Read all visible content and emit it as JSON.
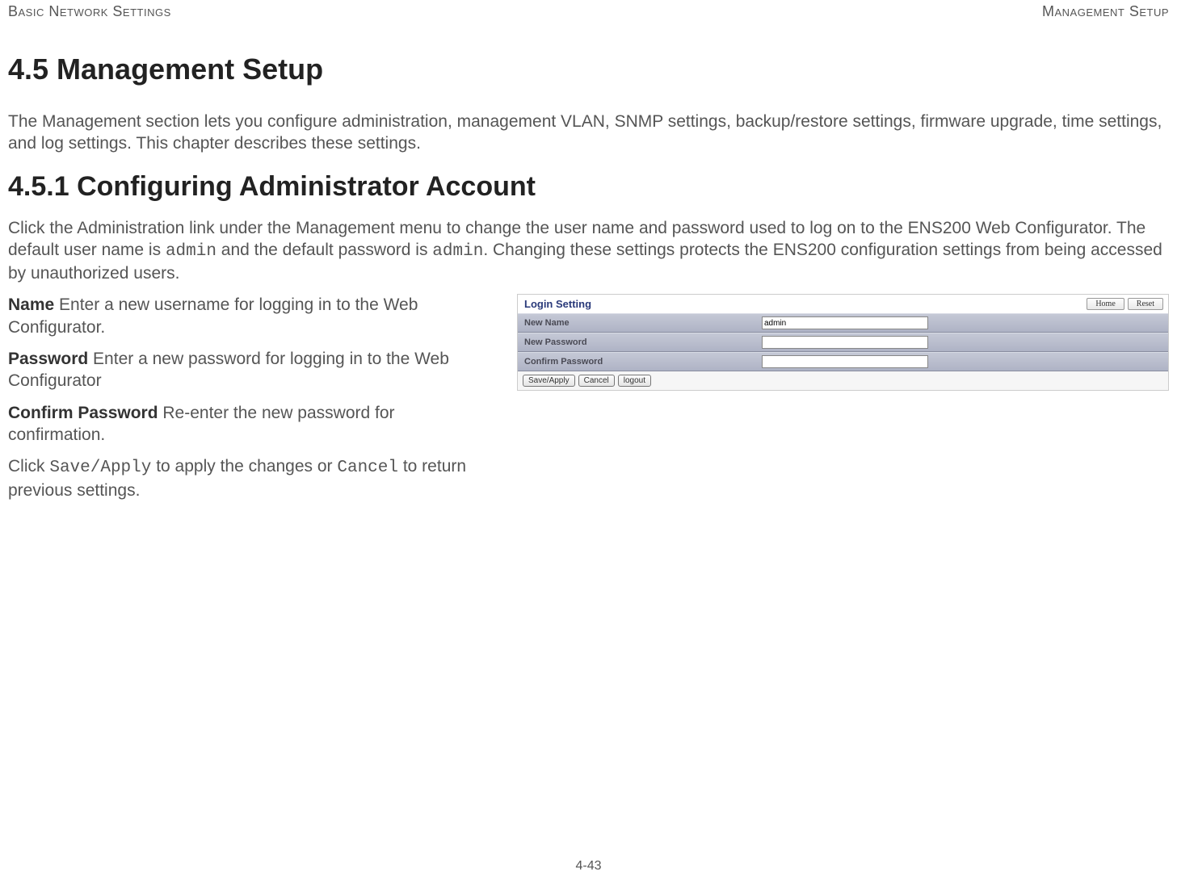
{
  "header": {
    "left": "Basic Network Settings",
    "right": "Management Setup"
  },
  "section_heading": "4.5 Management Setup",
  "intro_paragraph": "The Management section lets you configure administration, management VLAN, SNMP settings, backup/restore settings, firmware upgrade, time settings, and log settings. This chapter describes these settings.",
  "subsection_heading": "4.5.1 Configuring Administrator Account",
  "subsection_para_part1": "Click the Administration link under the Management menu to change the user name and password used to log on to the ENS200 Web Configurator. The default user name is ",
  "subsection_para_mono1": "admin",
  "subsection_para_part2": " and the default password is ",
  "subsection_para_mono2": "admin",
  "subsection_para_part3": ". Changing these settings protects the ENS200 configuration settings from being accessed by unauthorized users.",
  "definitions": {
    "name": {
      "term": "Name",
      "desc": "  Enter a new username for logging in to the Web Configurator."
    },
    "password": {
      "term": "Password",
      "desc": "  Enter a new password for logging in to the Web Configurator"
    },
    "confirm": {
      "term": "Confirm Password",
      "desc": "  Re-enter the new password for confirmation."
    }
  },
  "apply_line": {
    "p1": "Click ",
    "m1": "Save/Apply",
    "p2": " to apply the changes or ",
    "m2": "Cancel",
    "p3": " to return previous settings."
  },
  "screenshot": {
    "title": "Login Setting",
    "top_buttons": {
      "home": "Home",
      "reset": "Reset"
    },
    "rows": {
      "new_name": {
        "label": "New Name",
        "value": "admin"
      },
      "new_password": {
        "label": "New Password",
        "value": ""
      },
      "confirm_password": {
        "label": "Confirm Password",
        "value": ""
      }
    },
    "buttons": {
      "save_apply": "Save/Apply",
      "cancel": "Cancel",
      "logout": "logout"
    }
  },
  "footer": "4-43"
}
